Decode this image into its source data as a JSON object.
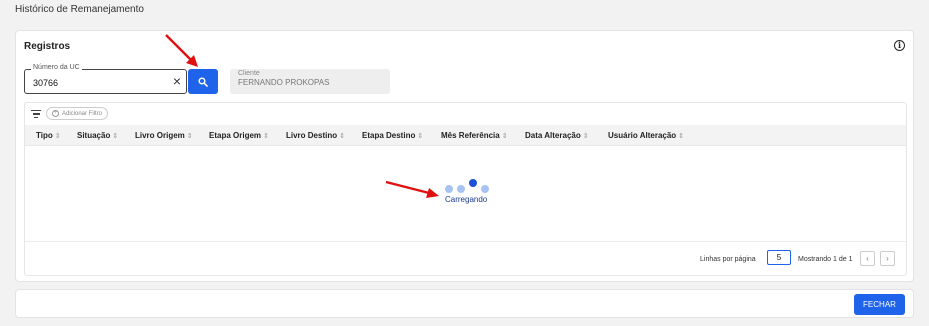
{
  "page": {
    "title": "Histórico de Remanejamento"
  },
  "card": {
    "title": "Registros",
    "info_icon": "info-icon"
  },
  "search": {
    "uc_label": "Número da UC",
    "uc_value": "30766",
    "clear_icon": "close-icon",
    "button_icon": "search-icon"
  },
  "client": {
    "label": "Cliente",
    "value": "FERNANDO PROKOPAS"
  },
  "table": {
    "filter_icon": "filter-icon",
    "add_filter_label": "Adicionar Filtro",
    "columns": [
      {
        "label": "Tipo",
        "sort": "⇕"
      },
      {
        "label": "Situação",
        "sort": "⇕"
      },
      {
        "label": "Livro Origem",
        "sort": "⇕"
      },
      {
        "label": "Etapa Origem",
        "sort": "⇕"
      },
      {
        "label": "Livro Destino",
        "sort": "⇕"
      },
      {
        "label": "Etapa Destino",
        "sort": "⇕"
      },
      {
        "label": "Mês Referência",
        "sort": "⇕"
      },
      {
        "label": "Data Alteração",
        "sort": "⇕"
      },
      {
        "label": "Usuário Alteração",
        "sort": "⇕"
      }
    ],
    "loading_text": "Carregando",
    "rows_per_page_label": "Linhas por página",
    "rows_per_page_value": "5",
    "showing_text": "Mostrando 1 de 1",
    "prev_icon": "‹",
    "next_icon": "›"
  },
  "footer": {
    "close_label": "FECHAR"
  },
  "colors": {
    "primary": "#1e63e9",
    "arrow": "#e01010",
    "loader_active": "#1e4fd8",
    "loader_idle": "#a8c3f2"
  }
}
